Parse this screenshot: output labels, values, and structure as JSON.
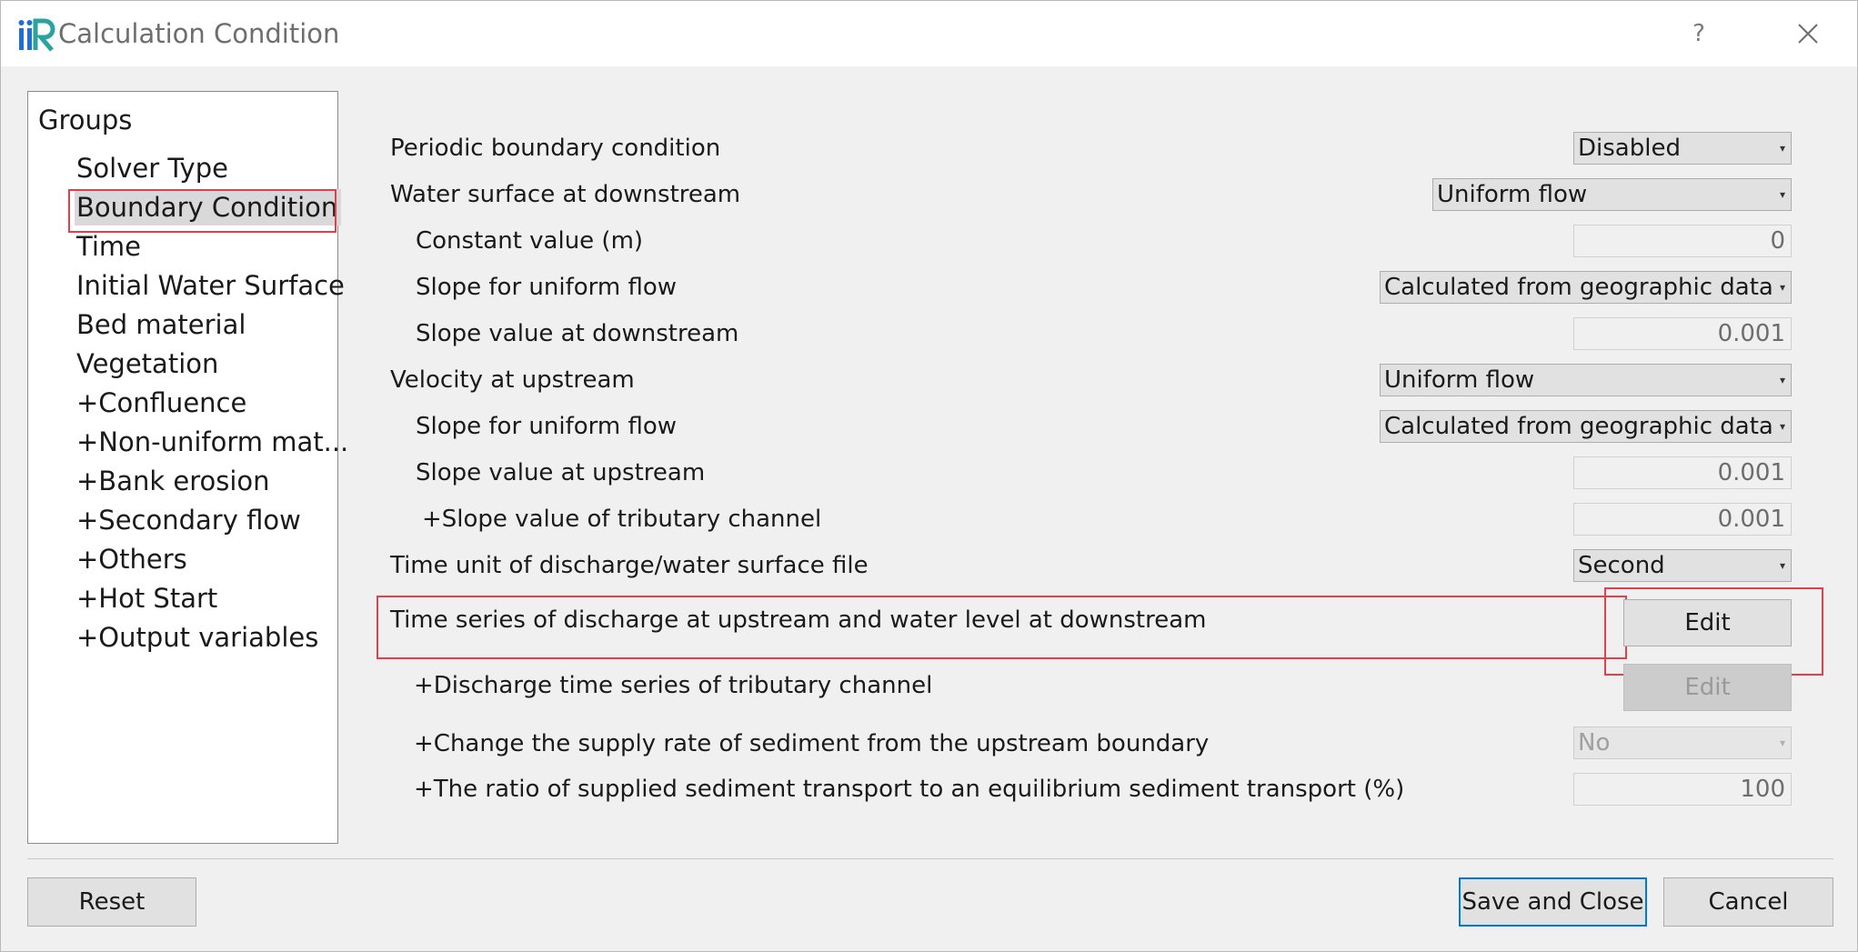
{
  "window": {
    "title": "Calculation Condition"
  },
  "titlebar": {
    "help_label": "?"
  },
  "groups": {
    "title": "Groups",
    "items": [
      {
        "label": "Solver Type"
      },
      {
        "label": "Boundary Condition",
        "selected": true
      },
      {
        "label": "Time"
      },
      {
        "label": "Initial Water Surface"
      },
      {
        "label": "Bed material"
      },
      {
        "label": "Vegetation"
      },
      {
        "label": "+Confluence"
      },
      {
        "label": "+Non-uniform mat..."
      },
      {
        "label": "+Bank erosion"
      },
      {
        "label": "+Secondary flow"
      },
      {
        "label": "+Others"
      },
      {
        "label": "+Hot Start"
      },
      {
        "label": "+Output variables"
      }
    ]
  },
  "form": {
    "periodic": {
      "label": "Periodic boundary condition",
      "value": "Disabled"
    },
    "ws_downstream": {
      "label": "Water surface at downstream",
      "value": "Uniform flow"
    },
    "constant_value": {
      "label": "Constant value (m)",
      "value": "0"
    },
    "slope_uniform_ds": {
      "label": "Slope for uniform flow",
      "value": "Calculated from geographic data"
    },
    "slope_value_ds": {
      "label": "Slope value at downstream",
      "value": "0.001"
    },
    "velocity_upstream": {
      "label": "Velocity at upstream",
      "value": "Uniform flow"
    },
    "slope_uniform_us": {
      "label": "Slope for uniform flow",
      "value": "Calculated from geographic data"
    },
    "slope_value_us": {
      "label": "Slope value at upstream",
      "value": "0.001"
    },
    "slope_tributary": {
      "label": "+Slope value of tributary channel",
      "value": "0.001"
    },
    "time_unit": {
      "label": "Time unit of discharge/water surface file",
      "value": "Second"
    },
    "time_series": {
      "label": "Time series of discharge at upstream and water level at downstream",
      "button": "Edit"
    },
    "tributary_series": {
      "label": "+Discharge time series of tributary channel",
      "button": "Edit"
    },
    "supply_rate": {
      "label": "+Change the supply rate of sediment from the upstream boundary",
      "value": "No"
    },
    "supply_ratio": {
      "label": "+The ratio of supplied sediment transport to an equilibrium sediment transport (%)",
      "value": "100"
    }
  },
  "footer": {
    "reset": "Reset",
    "save_close": "Save and Close",
    "cancel": "Cancel"
  },
  "colors": {
    "highlight": "#e0404a",
    "default_button_border": "#0078d7",
    "logo_blue": "#1f6fd1",
    "logo_teal": "#2aa3a0"
  }
}
